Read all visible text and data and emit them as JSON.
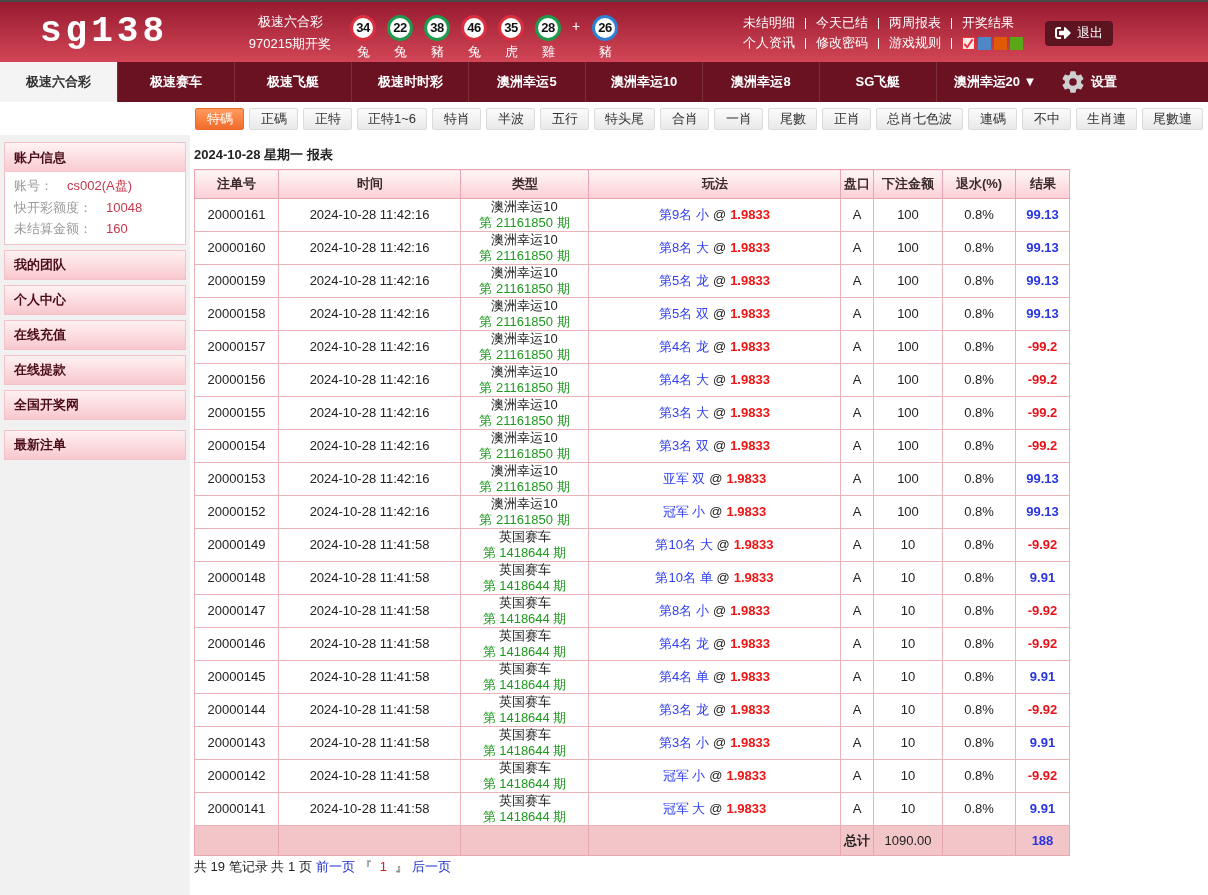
{
  "header": {
    "logo": "sg138",
    "lottery": {
      "name": "极速六合彩",
      "issue": "970215期开奖"
    },
    "balls": [
      {
        "number": "34",
        "zodiac": "兔",
        "color": "#d8303e"
      },
      {
        "number": "22",
        "zodiac": "兔",
        "color": "#1f9a4c"
      },
      {
        "number": "38",
        "zodiac": "豬",
        "color": "#1f9a4c"
      },
      {
        "number": "46",
        "zodiac": "兔",
        "color": "#d8303e"
      },
      {
        "number": "35",
        "zodiac": "虎",
        "color": "#d8303e"
      },
      {
        "number": "28",
        "zodiac": "雞",
        "color": "#1f9a4c"
      }
    ],
    "plus": "+",
    "special": {
      "number": "26",
      "zodiac": "豬",
      "color": "#2f80d0"
    },
    "link_rows": [
      {
        "links": [
          "未结明细",
          "今天已结",
          "两周报表",
          "开奖结果"
        ]
      },
      {
        "links": [
          "个人资讯",
          "修改密码",
          "游戏规则"
        ]
      }
    ],
    "swatches": [
      {
        "color": "#e8343c",
        "selected": true
      },
      {
        "color": "#4f87c6",
        "selected": false
      },
      {
        "color": "#e05a0a",
        "selected": false
      },
      {
        "color": "#5aa818",
        "selected": false
      }
    ],
    "logout": "退出"
  },
  "nav": {
    "tabs": [
      {
        "label": "极速六合彩",
        "selected": true
      },
      {
        "label": "极速赛车",
        "selected": false
      },
      {
        "label": "极速飞艇",
        "selected": false
      },
      {
        "label": "极速时时彩",
        "selected": false
      },
      {
        "label": "澳洲幸运5",
        "selected": false
      },
      {
        "label": "澳洲幸运10",
        "selected": false
      },
      {
        "label": "澳洲幸运8",
        "selected": false
      },
      {
        "label": "SG飞艇",
        "selected": false
      },
      {
        "label": "澳洲幸运20",
        "caret": "▼",
        "selected": false
      }
    ],
    "settings": "设置"
  },
  "subtabs": [
    {
      "label": "特碼",
      "selected": true
    },
    {
      "label": "正碼",
      "selected": false
    },
    {
      "label": "正特",
      "selected": false
    },
    {
      "label": "正特1~6",
      "selected": false
    },
    {
      "label": "特肖",
      "selected": false
    },
    {
      "label": "半波",
      "selected": false
    },
    {
      "label": "五行",
      "selected": false
    },
    {
      "label": "特头尾",
      "selected": false
    },
    {
      "label": "合肖",
      "selected": false
    },
    {
      "label": "一肖",
      "selected": false
    },
    {
      "label": "尾數",
      "selected": false
    },
    {
      "label": "正肖",
      "selected": false
    },
    {
      "label": "总肖七色波",
      "selected": false
    },
    {
      "label": "連碼",
      "selected": false
    },
    {
      "label": "不中",
      "selected": false
    },
    {
      "label": "生肖連",
      "selected": false
    },
    {
      "label": "尾數連",
      "selected": false
    }
  ],
  "sidebar": {
    "account": {
      "title": "账户信息",
      "fields": [
        {
          "label": "账号：",
          "value": "cs002(A盘)"
        },
        {
          "label": "快开彩额度：",
          "value": "10048"
        },
        {
          "label": "未结算金额：",
          "value": "160"
        }
      ]
    },
    "items": [
      "我的团队",
      "个人中心",
      "在线充值",
      "在线提款",
      "全国开奖网"
    ],
    "latest": "最新注单"
  },
  "report": {
    "title": "2024-10-28 星期一 报表",
    "columns": [
      "注单号",
      "时间",
      "类型",
      "玩法",
      "盘口",
      "下注金额",
      "退水(%)",
      "结果"
    ],
    "rows": [
      {
        "id": "20000161",
        "time": "2024-10-28 11:42:16",
        "game": "澳洲幸运10",
        "issue": "第 21161850 期",
        "bet": "第9名 小",
        "at": "@",
        "odds": "1.9833",
        "handicap": "A",
        "amount": "100",
        "rebate": "0.8%",
        "result": "99.13",
        "won": true
      },
      {
        "id": "20000160",
        "time": "2024-10-28 11:42:16",
        "game": "澳洲幸运10",
        "issue": "第 21161850 期",
        "bet": "第8名 大",
        "at": "@",
        "odds": "1.9833",
        "handicap": "A",
        "amount": "100",
        "rebate": "0.8%",
        "result": "99.13",
        "won": true
      },
      {
        "id": "20000159",
        "time": "2024-10-28 11:42:16",
        "game": "澳洲幸运10",
        "issue": "第 21161850 期",
        "bet": "第5名 龙",
        "at": "@",
        "odds": "1.9833",
        "handicap": "A",
        "amount": "100",
        "rebate": "0.8%",
        "result": "99.13",
        "won": true
      },
      {
        "id": "20000158",
        "time": "2024-10-28 11:42:16",
        "game": "澳洲幸运10",
        "issue": "第 21161850 期",
        "bet": "第5名 双",
        "at": "@",
        "odds": "1.9833",
        "handicap": "A",
        "amount": "100",
        "rebate": "0.8%",
        "result": "99.13",
        "won": true
      },
      {
        "id": "20000157",
        "time": "2024-10-28 11:42:16",
        "game": "澳洲幸运10",
        "issue": "第 21161850 期",
        "bet": "第4名 龙",
        "at": "@",
        "odds": "1.9833",
        "handicap": "A",
        "amount": "100",
        "rebate": "0.8%",
        "result": "-99.2",
        "won": false
      },
      {
        "id": "20000156",
        "time": "2024-10-28 11:42:16",
        "game": "澳洲幸运10",
        "issue": "第 21161850 期",
        "bet": "第4名 大",
        "at": "@",
        "odds": "1.9833",
        "handicap": "A",
        "amount": "100",
        "rebate": "0.8%",
        "result": "-99.2",
        "won": false
      },
      {
        "id": "20000155",
        "time": "2024-10-28 11:42:16",
        "game": "澳洲幸运10",
        "issue": "第 21161850 期",
        "bet": "第3名 大",
        "at": "@",
        "odds": "1.9833",
        "handicap": "A",
        "amount": "100",
        "rebate": "0.8%",
        "result": "-99.2",
        "won": false
      },
      {
        "id": "20000154",
        "time": "2024-10-28 11:42:16",
        "game": "澳洲幸运10",
        "issue": "第 21161850 期",
        "bet": "第3名 双",
        "at": "@",
        "odds": "1.9833",
        "handicap": "A",
        "amount": "100",
        "rebate": "0.8%",
        "result": "-99.2",
        "won": false
      },
      {
        "id": "20000153",
        "time": "2024-10-28 11:42:16",
        "game": "澳洲幸运10",
        "issue": "第 21161850 期",
        "bet": "亚军 双",
        "at": "@",
        "odds": "1.9833",
        "handicap": "A",
        "amount": "100",
        "rebate": "0.8%",
        "result": "99.13",
        "won": true
      },
      {
        "id": "20000152",
        "time": "2024-10-28 11:42:16",
        "game": "澳洲幸运10",
        "issue": "第 21161850 期",
        "bet": "冠军 小",
        "at": "@",
        "odds": "1.9833",
        "handicap": "A",
        "amount": "100",
        "rebate": "0.8%",
        "result": "99.13",
        "won": true
      },
      {
        "id": "20000149",
        "time": "2024-10-28 11:41:58",
        "game": "英国赛车",
        "issue": "第 1418644 期",
        "bet": "第10名 大",
        "at": "@",
        "odds": "1.9833",
        "handicap": "A",
        "amount": "10",
        "rebate": "0.8%",
        "result": "-9.92",
        "won": false
      },
      {
        "id": "20000148",
        "time": "2024-10-28 11:41:58",
        "game": "英国赛车",
        "issue": "第 1418644 期",
        "bet": "第10名 单",
        "at": "@",
        "odds": "1.9833",
        "handicap": "A",
        "amount": "10",
        "rebate": "0.8%",
        "result": "9.91",
        "won": true
      },
      {
        "id": "20000147",
        "time": "2024-10-28 11:41:58",
        "game": "英国赛车",
        "issue": "第 1418644 期",
        "bet": "第8名 小",
        "at": "@",
        "odds": "1.9833",
        "handicap": "A",
        "amount": "10",
        "rebate": "0.8%",
        "result": "-9.92",
        "won": false
      },
      {
        "id": "20000146",
        "time": "2024-10-28 11:41:58",
        "game": "英国赛车",
        "issue": "第 1418644 期",
        "bet": "第4名 龙",
        "at": "@",
        "odds": "1.9833",
        "handicap": "A",
        "amount": "10",
        "rebate": "0.8%",
        "result": "-9.92",
        "won": false
      },
      {
        "id": "20000145",
        "time": "2024-10-28 11:41:58",
        "game": "英国赛车",
        "issue": "第 1418644 期",
        "bet": "第4名 单",
        "at": "@",
        "odds": "1.9833",
        "handicap": "A",
        "amount": "10",
        "rebate": "0.8%",
        "result": "9.91",
        "won": true
      },
      {
        "id": "20000144",
        "time": "2024-10-28 11:41:58",
        "game": "英国赛车",
        "issue": "第 1418644 期",
        "bet": "第3名 龙",
        "at": "@",
        "odds": "1.9833",
        "handicap": "A",
        "amount": "10",
        "rebate": "0.8%",
        "result": "-9.92",
        "won": false
      },
      {
        "id": "20000143",
        "time": "2024-10-28 11:41:58",
        "game": "英国赛车",
        "issue": "第 1418644 期",
        "bet": "第3名 小",
        "at": "@",
        "odds": "1.9833",
        "handicap": "A",
        "amount": "10",
        "rebate": "0.8%",
        "result": "9.91",
        "won": true
      },
      {
        "id": "20000142",
        "time": "2024-10-28 11:41:58",
        "game": "英国赛车",
        "issue": "第 1418644 期",
        "bet": "冠军 小",
        "at": "@",
        "odds": "1.9833",
        "handicap": "A",
        "amount": "10",
        "rebate": "0.8%",
        "result": "-9.92",
        "won": false
      },
      {
        "id": "20000141",
        "time": "2024-10-28 11:41:58",
        "game": "英国赛车",
        "issue": "第 1418644 期",
        "bet": "冠军 大",
        "at": "@",
        "odds": "1.9833",
        "handicap": "A",
        "amount": "10",
        "rebate": "0.8%",
        "result": "9.91",
        "won": true
      }
    ],
    "total": {
      "label": "总计",
      "amount": "1090.00",
      "result": "188",
      "won": true
    }
  },
  "pagination": {
    "summary": "共 19 笔记录 共 1 页",
    "prev": "前一页",
    "open": "『",
    "page": "1",
    "close": "』",
    "next": "后一页"
  }
}
